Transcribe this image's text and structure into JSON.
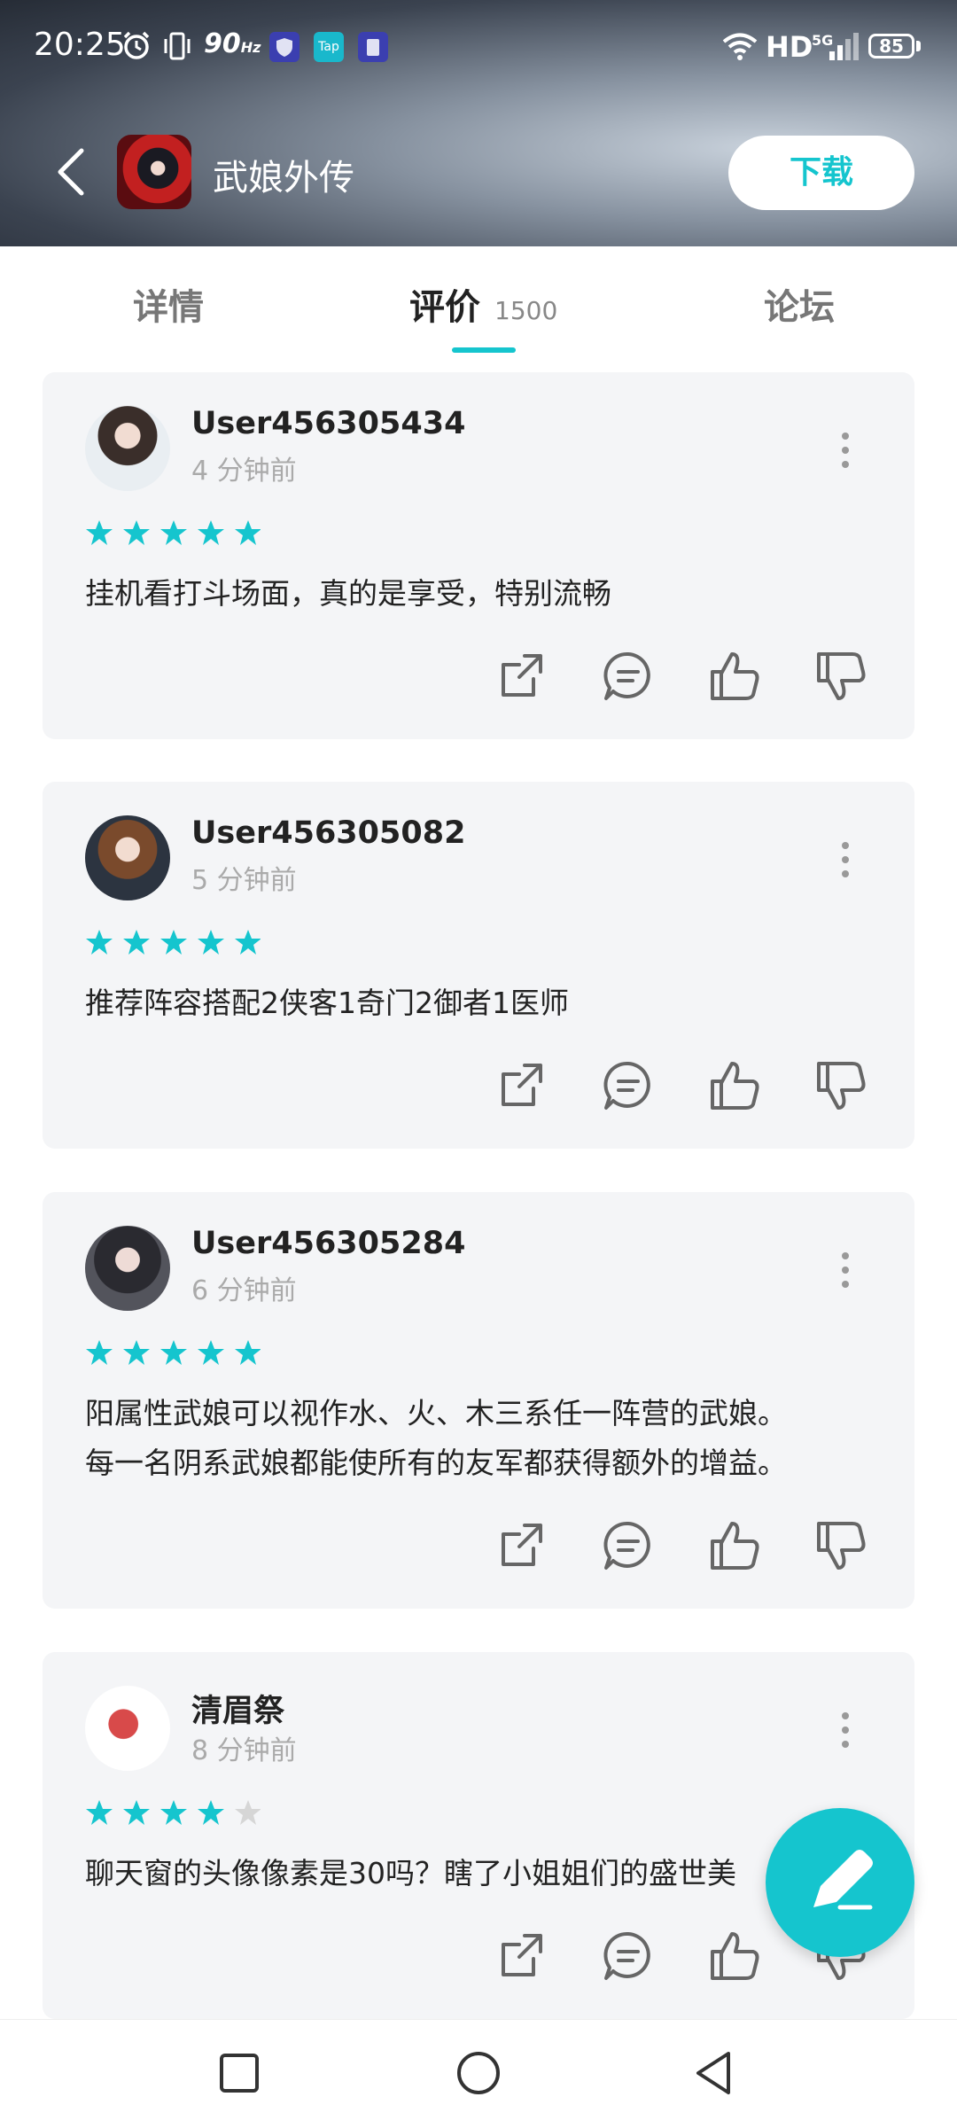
{
  "status_bar": {
    "time": "20:25",
    "refresh_rate": "90",
    "refresh_unit": "Hz",
    "network": "HD",
    "network_gen": "5G",
    "battery": "85",
    "badge_tap": "Tap"
  },
  "header": {
    "app_name": "武娘外传",
    "download_label": "下载"
  },
  "tabs": [
    {
      "label": "详情"
    },
    {
      "label": "评价",
      "count": "1500"
    },
    {
      "label": "论坛"
    }
  ],
  "reviews": [
    {
      "user": "User456305434",
      "time": "4 分钟前",
      "stars": 5,
      "text": "挂机看打斗场面，真的是享受，特别流畅"
    },
    {
      "user": "User456305082",
      "time": "5 分钟前",
      "stars": 5,
      "text": "推荐阵容搭配2侠客1奇门2御者1医师"
    },
    {
      "user": "User456305284",
      "time": "6 分钟前",
      "stars": 5,
      "text_line1": "阳属性武娘可以视作水、火、木三系任一阵营的武娘。",
      "text_line2": "每一名阴系武娘都能使所有的友军都获得额外的增益。"
    },
    {
      "user": "清眉祭",
      "time": "8 分钟前",
      "stars": 4,
      "text": "聊天窗的头像像素是30吗？瞎了小姐姐们的盛世美"
    }
  ],
  "colors": {
    "accent": "#15c5ce",
    "star_empty": "#d6d6d6",
    "card_bg": "#f4f5f7"
  },
  "icons": [
    "back-icon",
    "share-icon",
    "comment-icon",
    "thumbs-up-icon",
    "thumbs-down-icon",
    "more-icon",
    "edit-icon",
    "recent-apps-icon",
    "home-icon",
    "nav-back-icon"
  ]
}
